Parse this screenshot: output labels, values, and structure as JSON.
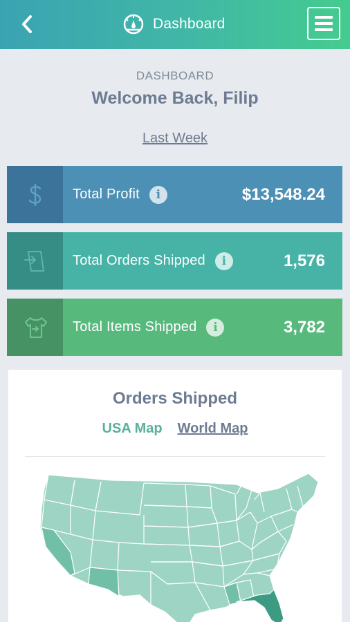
{
  "header": {
    "title": "Dashboard",
    "back_icon": "chevron-left-icon",
    "title_icon": "gauge-icon",
    "menu_icon": "hamburger-menu-icon"
  },
  "intro": {
    "overline": "DASHBOARD",
    "welcome": "Welcome Back, Filip",
    "period": "Last Week"
  },
  "stats": [
    {
      "label": "Total Profit",
      "value": "$13,548.24",
      "icon": "dollar-icon",
      "color": "#4d90b5"
    },
    {
      "label": "Total Orders Shipped",
      "value": "1,576",
      "icon": "order-export-icon",
      "color": "#46b3a6"
    },
    {
      "label": "Total Items Shipped",
      "value": "3,782",
      "icon": "tshirt-icon",
      "color": "#57b97c"
    }
  ],
  "orders_card": {
    "title": "Orders Shipped",
    "tabs": [
      "USA Map",
      "World Map"
    ],
    "active_tab": "USA Map",
    "map_colors": {
      "base": "#9ed4c3",
      "medium": "#72bfa8",
      "high": "#3d9a83",
      "borders": "#ffffff"
    }
  }
}
